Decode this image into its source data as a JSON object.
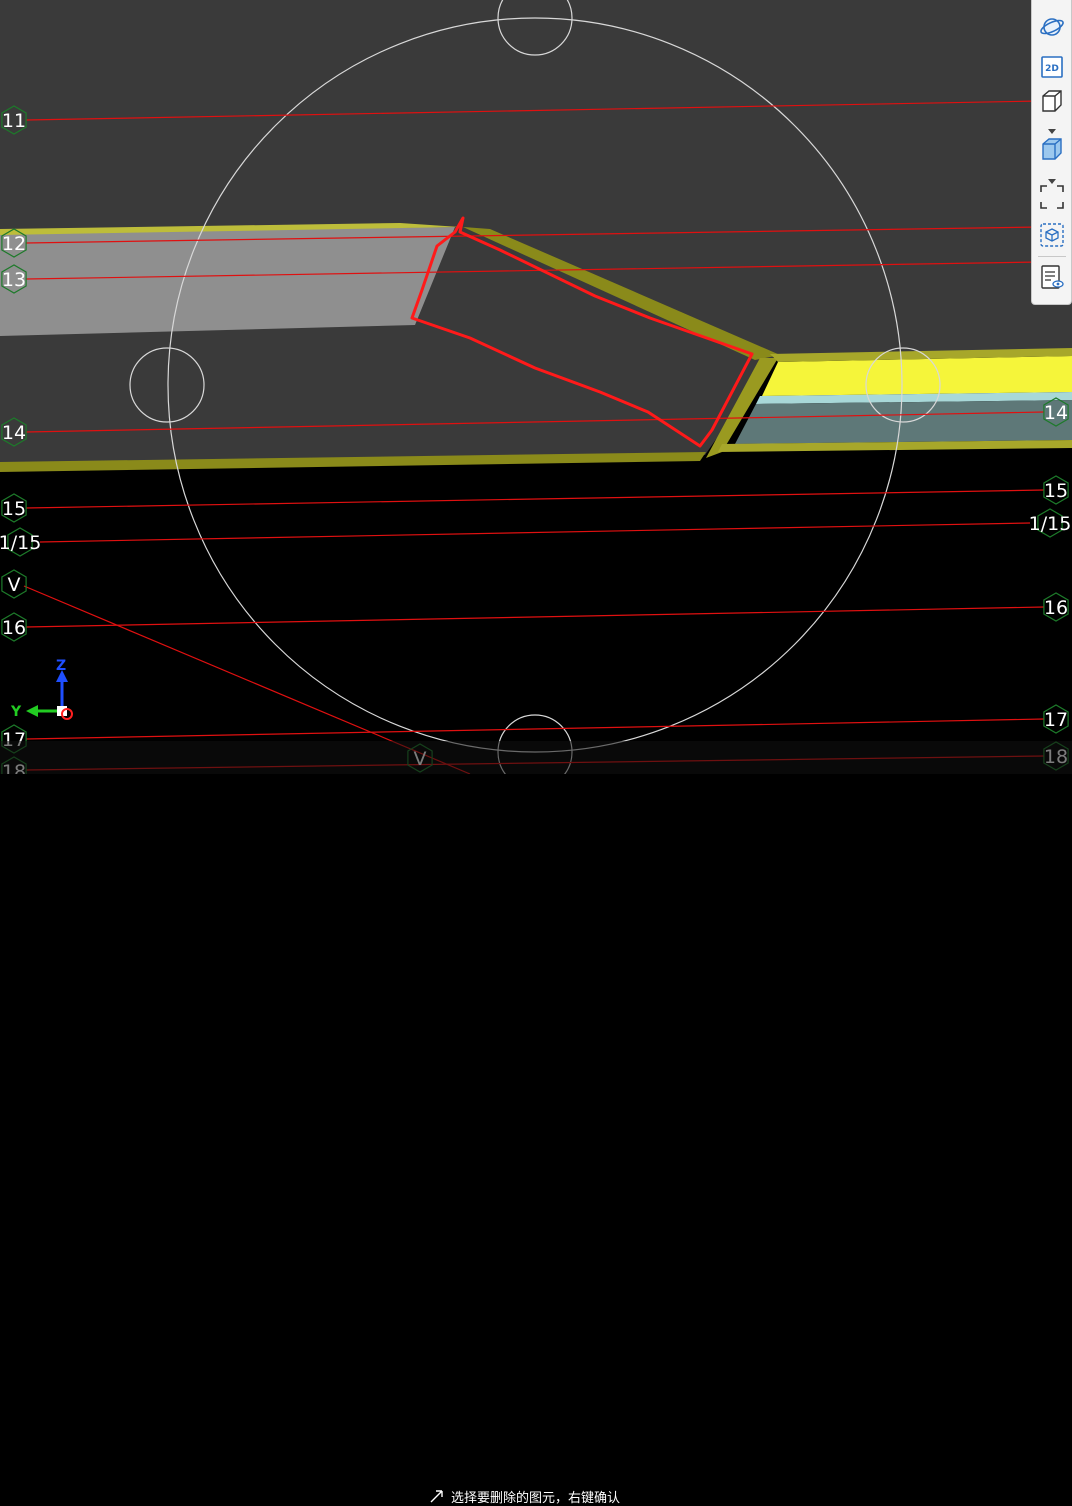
{
  "viewport": {
    "background_upper": "#3a3a3a",
    "background_lower": "#000000",
    "grid_line_color": "#e01010",
    "axis_bubble_color": "#1d7a2a",
    "left_axis_labels": [
      "11",
      "12",
      "13",
      "14",
      "15",
      "1/15",
      "V",
      "16",
      "17",
      "18"
    ],
    "right_axis_labels": [
      "14",
      "15",
      "1/15",
      "16",
      "17",
      "18"
    ],
    "bottom_label": "V"
  },
  "toolbar": {
    "buttons": [
      {
        "name": "orbit",
        "icon": "orbit-icon"
      },
      {
        "name": "2d-view",
        "icon": "2d-view-icon",
        "label": "2D"
      },
      {
        "name": "3d-view",
        "icon": "cube-wireframe-icon"
      },
      {
        "name": "shaded-view",
        "icon": "cube-shaded-icon"
      },
      {
        "name": "fit-view",
        "icon": "fullscreen-frame-icon"
      },
      {
        "name": "section-box",
        "icon": "section-box-icon"
      },
      {
        "name": "view-properties",
        "icon": "document-eye-icon"
      }
    ]
  },
  "view_cube": {
    "z_label": "Z",
    "y_label": "Y",
    "z_color": "#1f4fff",
    "y_color": "#22cc22",
    "x_color": "#ff2020"
  },
  "status": {
    "prompt": "选择要删除的图元，右键确认"
  }
}
